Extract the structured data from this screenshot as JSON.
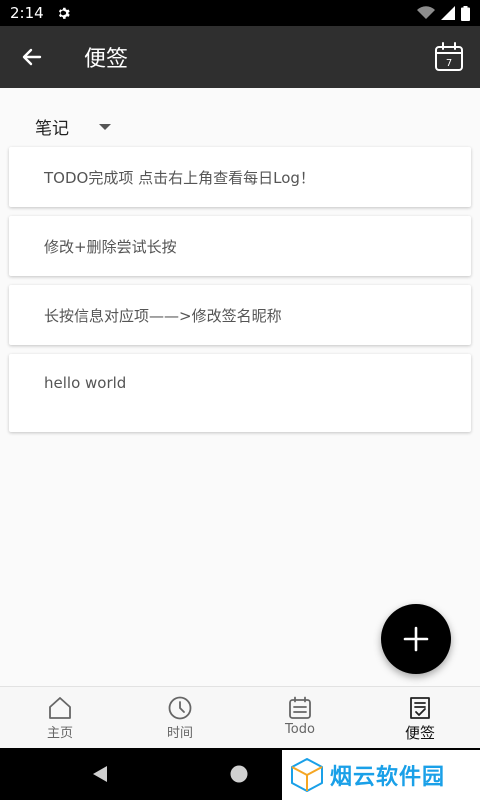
{
  "status_bar": {
    "time": "2:14"
  },
  "app_bar": {
    "title": "便签",
    "calendar_day": "7"
  },
  "category": {
    "label": "笔记"
  },
  "notes": [
    {
      "text": "TODO完成项 点击右上角查看每日Log！"
    },
    {
      "text": "修改+删除尝试长按"
    },
    {
      "text": "长按信息对应项——>修改签名昵称"
    },
    {
      "text": "hello world"
    }
  ],
  "bottom_nav": {
    "items": [
      {
        "label": "主页",
        "icon": "home-icon"
      },
      {
        "label": "时间",
        "icon": "clock-icon"
      },
      {
        "label": "Todo",
        "icon": "todo-icon"
      },
      {
        "label": "便签",
        "icon": "note-icon"
      }
    ],
    "active_index": 3
  },
  "watermark": {
    "text": "烟云软件园"
  }
}
